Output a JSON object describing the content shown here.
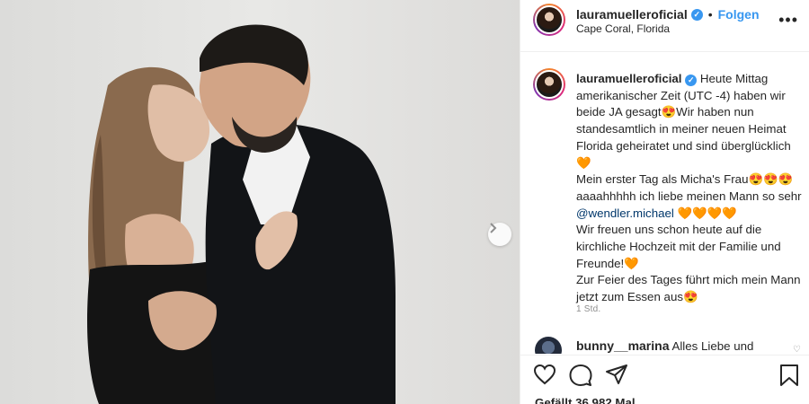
{
  "post": {
    "username": "lauramuelleroficial",
    "follow_label": "Folgen",
    "separator": "•",
    "location": "Cape Coral, Florida",
    "more_label": "•••"
  },
  "caption": {
    "username": "lauramuelleroficial",
    "part1": "Heute Mittag amerikanischer Zeit (UTC -4) haben wir beide JA gesagt😍Wir haben nun standesamtlich in meiner neuen Heimat Florida geheiratet und sind überglücklich🧡",
    "part2": "Mein erster Tag als Micha's Frau😍😍😍 aaaahhhhh ich liebe meinen Mann so sehr",
    "mention": "@wendler.michael",
    "part3": "🧡🧡🧡🧡",
    "part4": "Wir freuen uns schon heute auf die kirchliche Hochzeit mit der Familie und Freunde!🧡",
    "part5": "Zur Feier des Tages führt mich mein Mann jetzt zum Essen aus😍",
    "time": "1 Std."
  },
  "comment": {
    "username": "bunny__marina",
    "text": "Alles Liebe und"
  },
  "stats": {
    "likes_text": "Gefällt 36.982 Mal"
  },
  "icons": {
    "verified": "verified-badge-icon",
    "next": "chevron-right-icon",
    "like": "heart-icon",
    "comment": "comment-icon",
    "share": "paper-plane-icon",
    "save": "bookmark-icon"
  },
  "colors": {
    "accent": "#3897f0",
    "mention": "#00376b",
    "muted": "#8e8e8e"
  }
}
